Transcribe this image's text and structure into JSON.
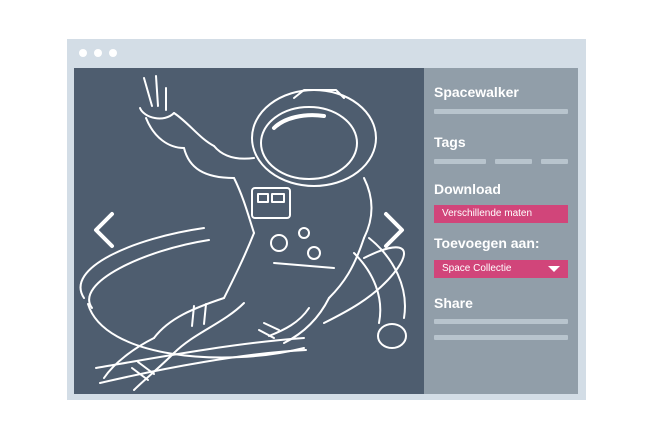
{
  "sidebar": {
    "title": "Spacewalker",
    "tags_heading": "Tags",
    "download_heading": "Download",
    "download_button": "Verschillende maten",
    "add_to_heading": "Toevoegen aan:",
    "collection_select": "Space Collectie",
    "share_heading": "Share"
  },
  "viewer": {
    "image_subject": "astronaut-spacewalker-illustration",
    "prev_icon": "chevron-left-icon",
    "next_icon": "chevron-right-icon"
  },
  "colors": {
    "background": "#ffffff",
    "window_frame": "#d3dde6",
    "image_bg": "#4e5d6f",
    "sidebar_bg": "#919ea9",
    "accent": "#d1457a",
    "placeholder_line": "#b8c4cd"
  }
}
